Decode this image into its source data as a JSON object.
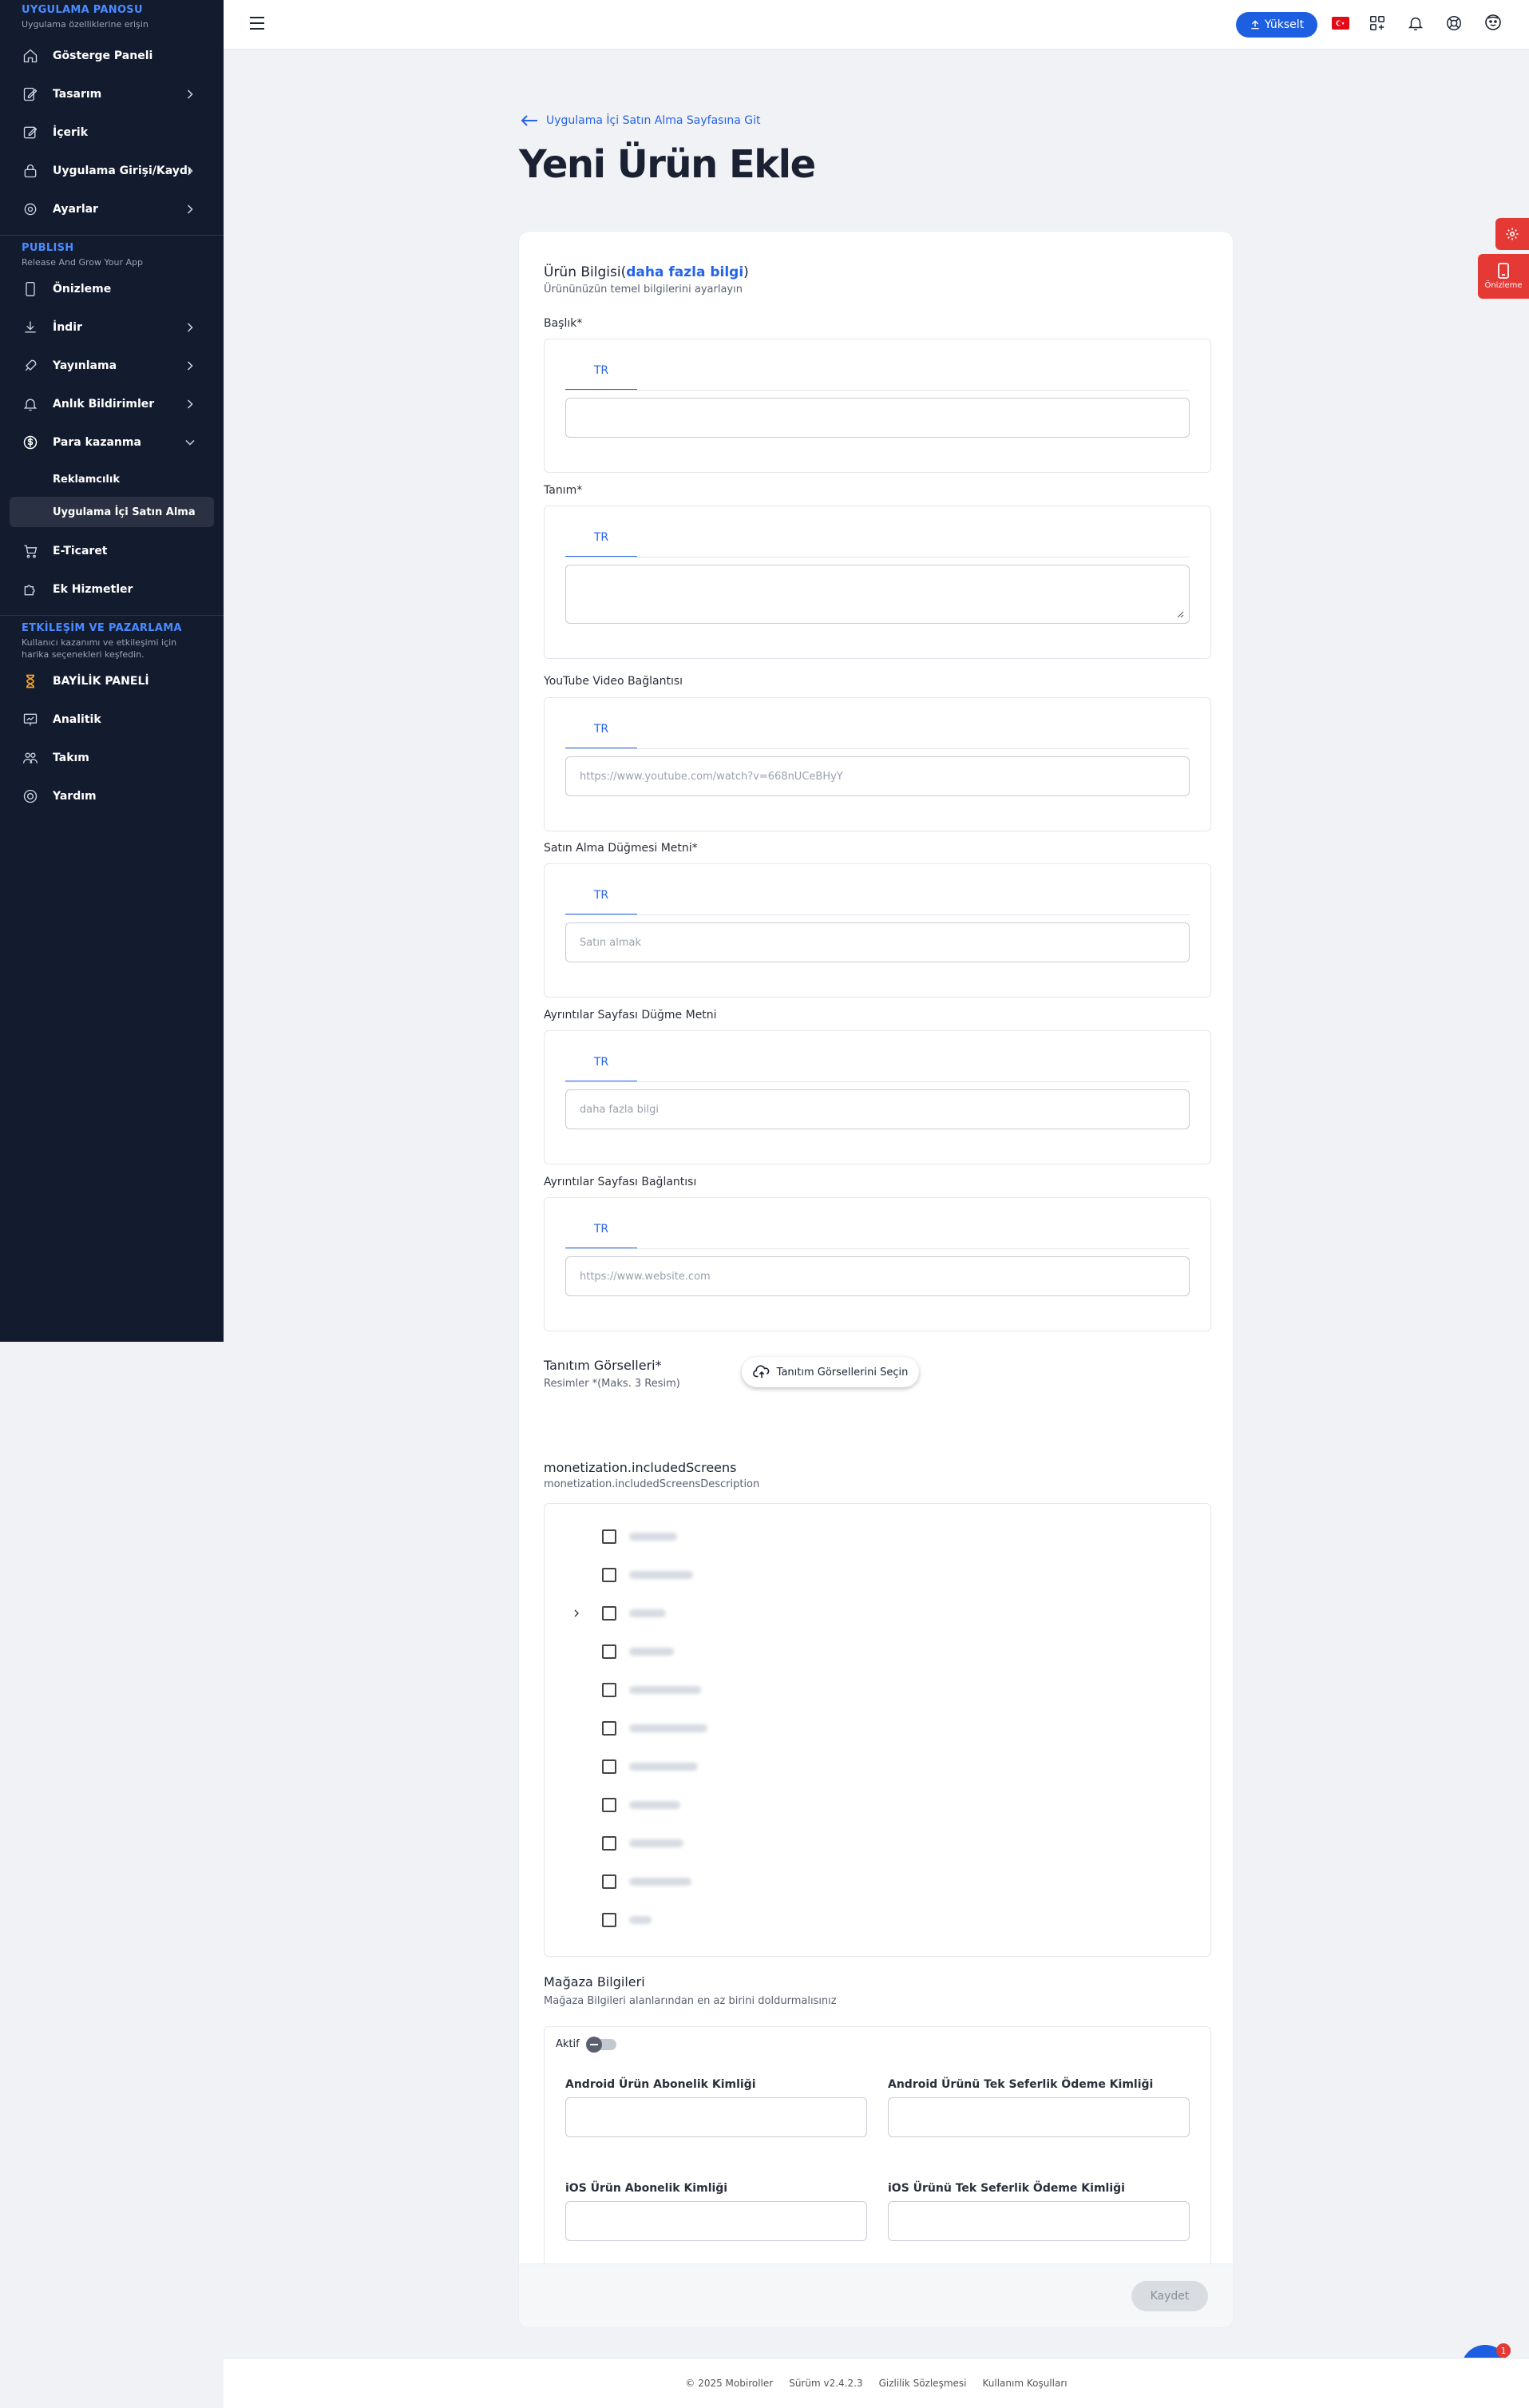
{
  "sidebar": {
    "section1": {
      "title": "UYGULAMA PANOSU",
      "subtitle": "Uygulama özelliklerine erişin"
    },
    "items1": [
      {
        "label": "Gösterge Paneli",
        "icon": "home-icon"
      },
      {
        "label": "Tasarım",
        "icon": "design-icon"
      },
      {
        "label": "İçerik",
        "icon": "edit-icon"
      },
      {
        "label": "Uygulama Girişi/Kaydı",
        "icon": "login-icon"
      },
      {
        "label": "Ayarlar",
        "icon": "gear-icon"
      }
    ],
    "section2": {
      "title": "PUBLISH",
      "subtitle": "Release And Grow Your App"
    },
    "items2": [
      {
        "label": "Önizleme",
        "icon": "phone-icon"
      },
      {
        "label": "İndir",
        "icon": "download-icon"
      },
      {
        "label": "Yayınlama",
        "icon": "rocket-icon"
      },
      {
        "label": "Anlık Bildirimler",
        "icon": "bell-icon"
      },
      {
        "label": "Para kazanma",
        "icon": "dollar-icon"
      }
    ],
    "sub": [
      {
        "label": "Reklamcılık"
      },
      {
        "label": "Uygulama İçi Satın Alma"
      }
    ],
    "items3": [
      {
        "label": "E-Ticaret",
        "icon": "cart-icon"
      },
      {
        "label": "Ek Hizmetler",
        "icon": "puzzle-icon"
      }
    ],
    "section3": {
      "title": "ETKİLEŞİM VE PAZARLAMA",
      "subtitle": "Kullanıcı kazanımı ve etkileşimi için harika seçenekleri keşfedin."
    },
    "items4": [
      {
        "label": "BAYİLİK PANELİ",
        "icon": "hourglass-icon"
      },
      {
        "label": "Analitik",
        "icon": "analytics-icon"
      },
      {
        "label": "Takım",
        "icon": "team-icon"
      },
      {
        "label": "Yardım",
        "icon": "help-icon"
      }
    ]
  },
  "topbar": {
    "upgrade": "Yükselt"
  },
  "page": {
    "back_link": "Uygulama İçi Satın Alma Sayfasına Git",
    "title": "Yeni Ürün Ekle"
  },
  "form": {
    "info_title": "Ürün Bilgisi(",
    "info_link": "daha fazla bilgi",
    "info_close": ")",
    "info_sub": "Ürününüzün temel bilgilerini ayarlayın",
    "lang_tab": "TR",
    "fields": [
      {
        "label": "Başlık*",
        "placeholder": ""
      },
      {
        "label": "Tanım*",
        "placeholder": ""
      },
      {
        "label": "YouTube Video Bağlantısı",
        "placeholder": "https://www.youtube.com/watch?v=668nUCeBHyY"
      },
      {
        "label": "Satın Alma Düğmesi Metni*",
        "placeholder": "Satın almak"
      },
      {
        "label": "Ayrıntılar Sayfası Düğme Metni",
        "placeholder": "daha fazla bilgi"
      },
      {
        "label": "Ayrıntılar Sayfası Bağlantısı",
        "placeholder": "https://www.website.com"
      }
    ],
    "promo_title": "Tanıtım Görselleri*",
    "promo_sub": "Resimler *(Maks. 3 Resim)",
    "promo_button": "Tanıtım Görsellerini Seçin",
    "screens_title": "monetization.includedScreens",
    "screens_sub": "monetization.includedScreensDescription",
    "store_title": "Mağaza Bilgileri",
    "store_sub": "Mağaza Bilgileri alanlarından en az birini doldurmalısınız",
    "active_label": "Aktif",
    "android_sub": "Android Ürün Abonelik Kimliği",
    "android_once": "Android Ürünü Tek Seferlik Ödeme Kimliği",
    "ios_sub": "iOS Ürün Abonelik Kimliği",
    "ios_once": "iOS Ürünü Tek Seferlik Ödeme Kimliği",
    "save": "Kaydet"
  },
  "side_widgets": {
    "preview": "Önizleme",
    "chat_badge": "1"
  },
  "footer": {
    "copyright": "© 2025 Mobiroller",
    "version": "Sürüm v2.4.2.3",
    "privacy": "Gizlilik Sözleşmesi",
    "terms": "Kullanım Koşulları"
  },
  "colors": {
    "accent": "#2563eb",
    "sidebar": "#131b2e",
    "danger": "#e53935"
  }
}
